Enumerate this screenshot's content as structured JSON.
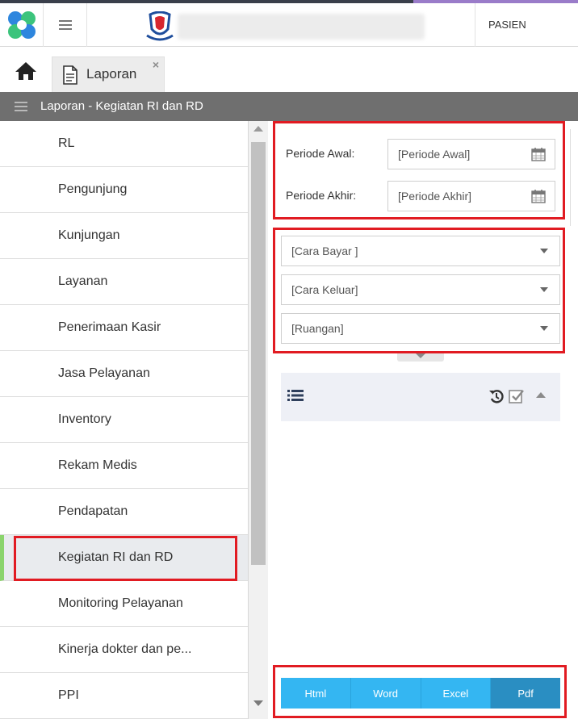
{
  "header": {
    "user_label": "PASIEN"
  },
  "tabs": [
    {
      "label": "Laporan",
      "close": "×"
    }
  ],
  "page_title": "Laporan - Kegiatan RI dan RD",
  "sidebar": {
    "items": [
      {
        "label": "RL"
      },
      {
        "label": "Pengunjung"
      },
      {
        "label": "Kunjungan"
      },
      {
        "label": "Layanan"
      },
      {
        "label": "Penerimaan Kasir"
      },
      {
        "label": "Jasa Pelayanan"
      },
      {
        "label": "Inventory"
      },
      {
        "label": "Rekam Medis"
      },
      {
        "label": "Pendapatan"
      },
      {
        "label": "Kegiatan RI dan RD",
        "active": true
      },
      {
        "label": "Monitoring Pelayanan"
      },
      {
        "label": "Kinerja dokter dan pe..."
      },
      {
        "label": "PPI"
      }
    ]
  },
  "filters": {
    "periode_awal_label": "Periode Awal:",
    "periode_awal_placeholder": "[Periode Awal]",
    "periode_akhir_label": "Periode Akhir:",
    "periode_akhir_placeholder": "[Periode Akhir]",
    "cara_bayar": "[Cara Bayar ]",
    "cara_keluar": "[Cara Keluar]",
    "ruangan": "[Ruangan]"
  },
  "export_buttons": {
    "html": "Html",
    "word": "Word",
    "excel": "Excel",
    "pdf": "Pdf"
  },
  "colors": {
    "highlight": "#e11b22",
    "button_blue": "#34b6f2",
    "button_active": "#2a8ec2",
    "active_marker": "#8bd46c",
    "header_gray": "#6f6f6f"
  }
}
